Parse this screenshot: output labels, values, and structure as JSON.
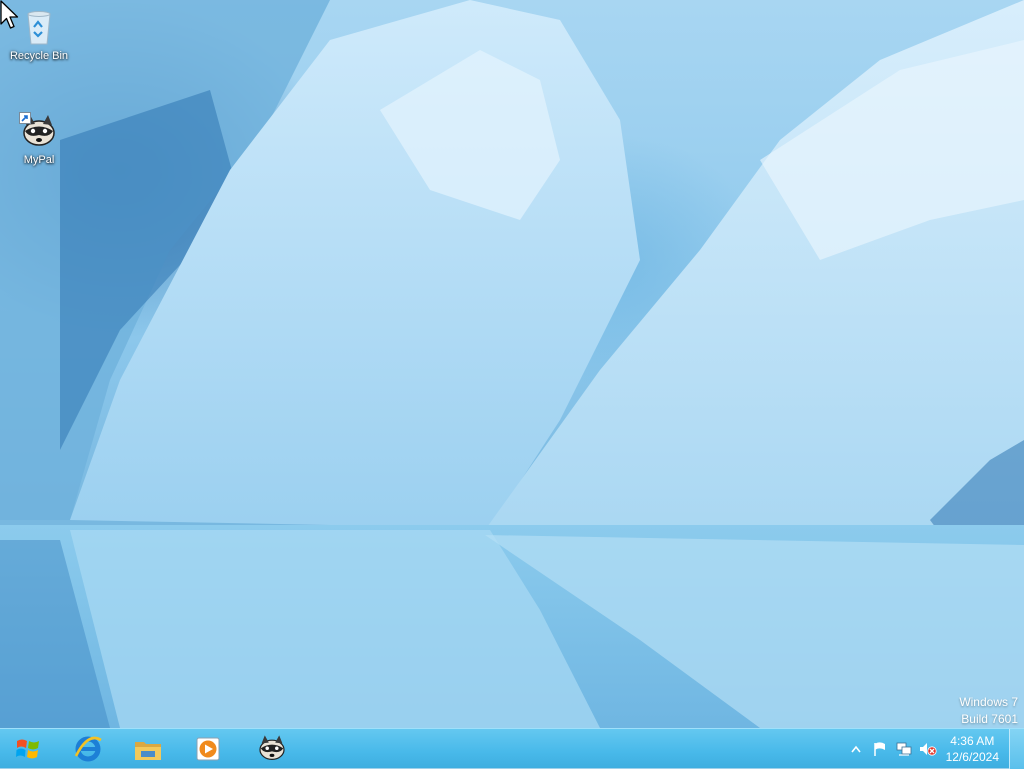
{
  "desktop": {
    "icons": [
      {
        "label": "Recycle Bin",
        "icon": "recycle-bin-icon"
      },
      {
        "label": "MyPal",
        "icon": "raccoon-app-icon"
      }
    ],
    "watermark": {
      "line1": "Windows 7",
      "line2": "Build 7601"
    }
  },
  "taskbar": {
    "start": {
      "icon": "windows-start-icon"
    },
    "pinned": [
      {
        "icon": "internet-explorer-icon"
      },
      {
        "icon": "file-explorer-icon"
      },
      {
        "icon": "media-player-icon"
      },
      {
        "icon": "raccoon-app-icon"
      }
    ],
    "tray": {
      "icons": [
        "show-hidden-icons-icon",
        "action-center-flag-icon",
        "network-icon",
        "volume-muted-icon"
      ],
      "clock": {
        "time": "4:36 AM",
        "date": "12/6/2024"
      }
    }
  },
  "colors": {
    "taskbar": "#48b9ea",
    "wallpaper": "#8dc8ec"
  }
}
